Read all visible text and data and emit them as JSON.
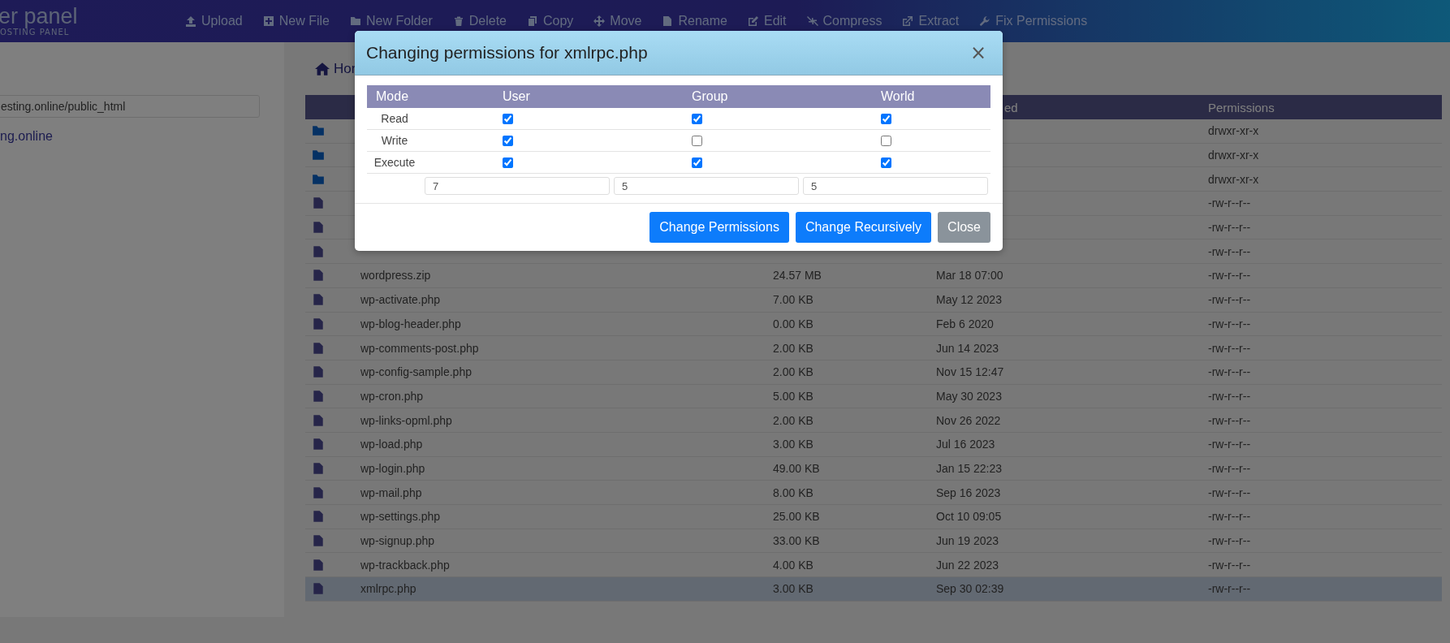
{
  "logo": {
    "name": "er panel",
    "tagline": "OSTING PANEL"
  },
  "toolbar": [
    {
      "label": "Upload",
      "kind": "upload"
    },
    {
      "label": "New File",
      "kind": "plus"
    },
    {
      "label": "New Folder",
      "kind": "folder"
    },
    {
      "label": "Delete",
      "kind": "trash"
    },
    {
      "label": "Copy",
      "kind": "copy"
    },
    {
      "label": "Move",
      "kind": "move"
    },
    {
      "label": "Rename",
      "kind": "file"
    },
    {
      "label": "Edit",
      "kind": "edit"
    },
    {
      "label": "Compress",
      "kind": "compress"
    },
    {
      "label": "Extract",
      "kind": "extract"
    },
    {
      "label": "Fix Permissions",
      "kind": "wrench"
    }
  ],
  "sidebar": {
    "path": "esting.online/public_html",
    "tree": [
      {
        "label": "ng.online"
      }
    ]
  },
  "breadcrumb": "Hor",
  "table": {
    "columns": [
      {
        "label": "ed"
      },
      {
        "label": "Permissions"
      }
    ],
    "rows": [
      {
        "kind": "folder",
        "permissions": "drwxr-xr-x",
        "selected": false
      },
      {
        "kind": "folder",
        "permissions": "drwxr-xr-x",
        "selected": false
      },
      {
        "kind": "folder",
        "permissions": "drwxr-xr-x",
        "selected": false
      },
      {
        "kind": "file",
        "permissions": "-rw-r--r--",
        "selected": false
      },
      {
        "kind": "file",
        "permissions": "-rw-r--r--",
        "selected": false
      },
      {
        "kind": "file",
        "permissions": "-rw-r--r--",
        "selected": false
      },
      {
        "kind": "file",
        "name": "wordpress.zip",
        "size": "24.57 MB",
        "modified": "Mar 18 07:00",
        "permissions": "-rw-r--r--",
        "selected": false
      },
      {
        "kind": "file",
        "name": "wp-activate.php",
        "size": "7.00 KB",
        "modified": "May 12 2023",
        "permissions": "-rw-r--r--",
        "selected": false
      },
      {
        "kind": "file",
        "name": "wp-blog-header.php",
        "size": "0.00 KB",
        "modified": "Feb 6 2020",
        "permissions": "-rw-r--r--",
        "selected": false
      },
      {
        "kind": "file",
        "name": "wp-comments-post.php",
        "size": "2.00 KB",
        "modified": "Jun 14 2023",
        "permissions": "-rw-r--r--",
        "selected": false
      },
      {
        "kind": "file",
        "name": "wp-config-sample.php",
        "size": "2.00 KB",
        "modified": "Nov 15 12:47",
        "permissions": "-rw-r--r--",
        "selected": false
      },
      {
        "kind": "file",
        "name": "wp-cron.php",
        "size": "5.00 KB",
        "modified": "May 30 2023",
        "permissions": "-rw-r--r--",
        "selected": false
      },
      {
        "kind": "file",
        "name": "wp-links-opml.php",
        "size": "2.00 KB",
        "modified": "Nov 26 2022",
        "permissions": "-rw-r--r--",
        "selected": false
      },
      {
        "kind": "file",
        "name": "wp-load.php",
        "size": "3.00 KB",
        "modified": "Jul 16 2023",
        "permissions": "-rw-r--r--",
        "selected": false
      },
      {
        "kind": "file",
        "name": "wp-login.php",
        "size": "49.00 KB",
        "modified": "Jan 15 22:23",
        "permissions": "-rw-r--r--",
        "selected": false
      },
      {
        "kind": "file",
        "name": "wp-mail.php",
        "size": "8.00 KB",
        "modified": "Sep 16 2023",
        "permissions": "-rw-r--r--",
        "selected": false
      },
      {
        "kind": "file",
        "name": "wp-settings.php",
        "size": "25.00 KB",
        "modified": "Oct 10 09:05",
        "permissions": "-rw-r--r--",
        "selected": false
      },
      {
        "kind": "file",
        "name": "wp-signup.php",
        "size": "33.00 KB",
        "modified": "Jun 19 2023",
        "permissions": "-rw-r--r--",
        "selected": false
      },
      {
        "kind": "file",
        "name": "wp-trackback.php",
        "size": "4.00 KB",
        "modified": "Jun 22 2023",
        "permissions": "-rw-r--r--",
        "selected": false
      },
      {
        "kind": "file",
        "name": "xmlrpc.php",
        "size": "3.00 KB",
        "modified": "Sep 30 02:39",
        "permissions": "-rw-r--r--",
        "selected": true
      }
    ]
  },
  "dialog": {
    "title": "Changing permissions for xmlrpc.php",
    "close": "×",
    "columns": [
      "Mode",
      "User",
      "Group",
      "World"
    ],
    "modes": [
      {
        "label": "Read",
        "user": true,
        "group": true,
        "world": true
      },
      {
        "label": "Write",
        "user": true,
        "group": false,
        "world": false
      },
      {
        "label": "Execute",
        "user": true,
        "group": true,
        "world": true
      }
    ],
    "values": [
      "7",
      "5",
      "5"
    ],
    "buttons": [
      {
        "label": "Change Permissions",
        "kind": "primary"
      },
      {
        "label": "Change Recursively",
        "kind": "primary"
      },
      {
        "label": "Close",
        "kind": "secondary"
      }
    ]
  }
}
